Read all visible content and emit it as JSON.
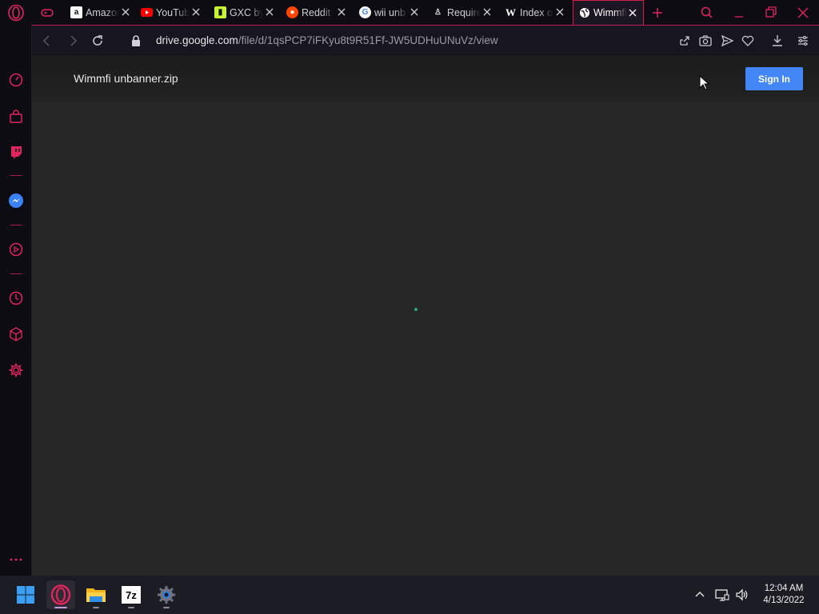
{
  "browser": {
    "tabs": [
      {
        "title": "Amazon",
        "favicon": "amazon-icon"
      },
      {
        "title": "YouTube",
        "favicon": "youtube-icon"
      },
      {
        "title": "GXC by",
        "favicon": "gxc-icon"
      },
      {
        "title": "Reddit",
        "favicon": "reddit-icon"
      },
      {
        "title": "wii unb",
        "favicon": "google-icon"
      },
      {
        "title": "Require",
        "favicon": "require-icon"
      },
      {
        "title": "Index of",
        "favicon": "wiki-icon"
      },
      {
        "title": "Wimmfi",
        "favicon": "globe-icon",
        "active": true
      }
    ],
    "address": {
      "host": "drive.google.com",
      "path": "/file/d/1qsPCP7iFKyu8t9R51Ff-JW5UDHuUNuVz/view"
    }
  },
  "page": {
    "file_name": "Wimmfi unbanner.zip",
    "sign_in_label": "Sign In",
    "loading": true
  },
  "taskbar": {
    "apps": [
      "windows-start-icon",
      "opera-icon",
      "file-explorer-icon",
      "7zip-icon",
      "settings-icon"
    ],
    "seven_zip_label": "7z",
    "clock": {
      "time": "12:04 AM",
      "date": "4/13/2022"
    }
  },
  "colors": {
    "accent": "#e0245e",
    "page_bg": "#262626",
    "sign_in": "#4285f4",
    "tab_bg": "#0d0c13"
  }
}
